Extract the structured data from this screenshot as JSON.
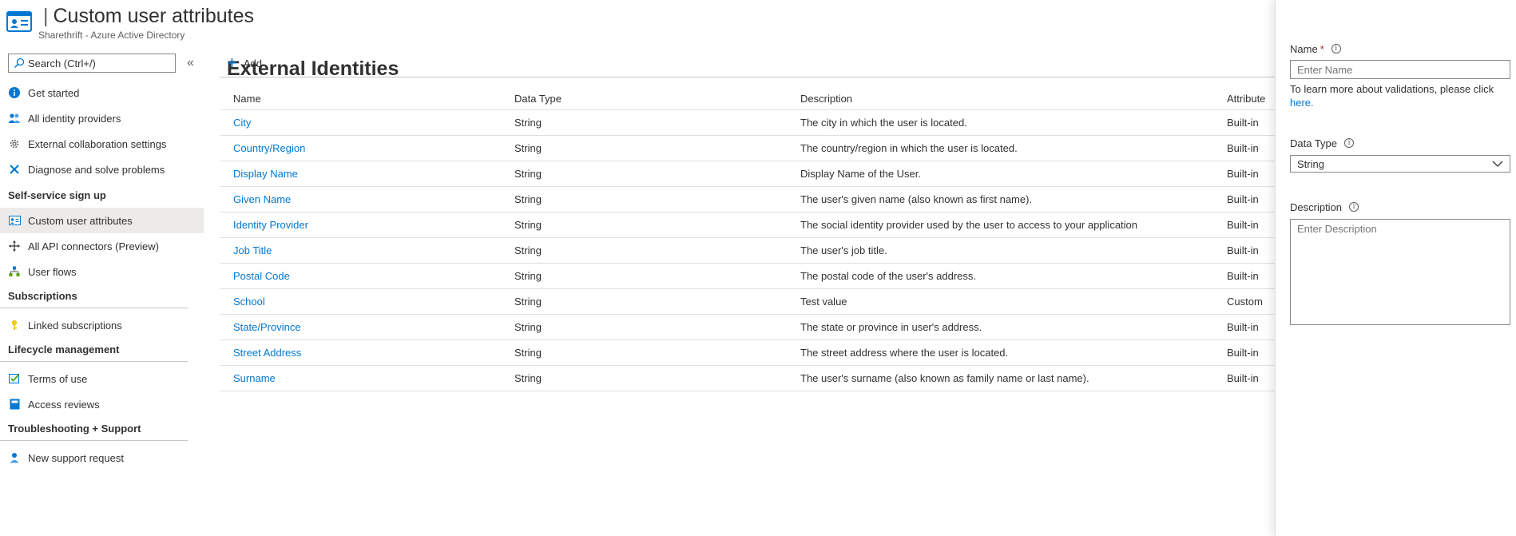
{
  "header": {
    "title_main": "External Identities",
    "title_sep": "|",
    "title_sub": "Custom user attributes",
    "subtitle": "Sharethrift - Azure Active Directory"
  },
  "sidebar": {
    "search_placeholder": "Search (Ctrl+/)",
    "collapse": "«",
    "top_items": [
      {
        "label": "Get started",
        "icon": "info-icon"
      },
      {
        "label": "All identity providers",
        "icon": "people-icon"
      },
      {
        "label": "External collaboration settings",
        "icon": "gear-icon"
      },
      {
        "label": "Diagnose and solve problems",
        "icon": "wrench-icon"
      }
    ],
    "sections": [
      {
        "label": "Self-service sign up",
        "items": [
          {
            "label": "Custom user attributes",
            "icon": "id-card-icon",
            "active": true
          },
          {
            "label": "All API connectors (Preview)",
            "icon": "move-icon"
          },
          {
            "label": "User flows",
            "icon": "flow-icon"
          }
        ]
      },
      {
        "label": "Subscriptions",
        "items": [
          {
            "label": "Linked subscriptions",
            "icon": "key-icon"
          }
        ]
      },
      {
        "label": "Lifecycle management",
        "items": [
          {
            "label": "Terms of use",
            "icon": "checklist-icon"
          },
          {
            "label": "Access reviews",
            "icon": "book-icon"
          }
        ]
      },
      {
        "label": "Troubleshooting + Support",
        "items": [
          {
            "label": "New support request",
            "icon": "person-support-icon"
          }
        ]
      }
    ]
  },
  "toolbar": {
    "add_label": "Add"
  },
  "table": {
    "headers": [
      "Name",
      "Data Type",
      "Description",
      "Attribute"
    ],
    "rows": [
      [
        "City",
        "String",
        "The city in which the user is located.",
        "Built-in"
      ],
      [
        "Country/Region",
        "String",
        "The country/region in which the user is located.",
        "Built-in"
      ],
      [
        "Display Name",
        "String",
        "Display Name of the User.",
        "Built-in"
      ],
      [
        "Given Name",
        "String",
        "The user's given name (also known as first name).",
        "Built-in"
      ],
      [
        "Identity Provider",
        "String",
        "The social identity provider used by the user to access to your application",
        "Built-in"
      ],
      [
        "Job Title",
        "String",
        "The user's job title.",
        "Built-in"
      ],
      [
        "Postal Code",
        "String",
        "The postal code of the user's address.",
        "Built-in"
      ],
      [
        "School",
        "String",
        "Test value",
        "Custom"
      ],
      [
        "State/Province",
        "String",
        "The state or province in user's address.",
        "Built-in"
      ],
      [
        "Street Address",
        "String",
        "The street address where the user is located.",
        "Built-in"
      ],
      [
        "Surname",
        "String",
        "The user's surname (also known as family name or last name).",
        "Built-in"
      ]
    ]
  },
  "panel": {
    "name_label": "Name",
    "required_mark": "*",
    "name_placeholder": "Enter Name",
    "help_text": "To learn more about validations, please click",
    "help_link": "here.",
    "datatype_label": "Data Type",
    "datatype_value": "String",
    "description_label": "Description",
    "description_placeholder": "Enter Description"
  }
}
